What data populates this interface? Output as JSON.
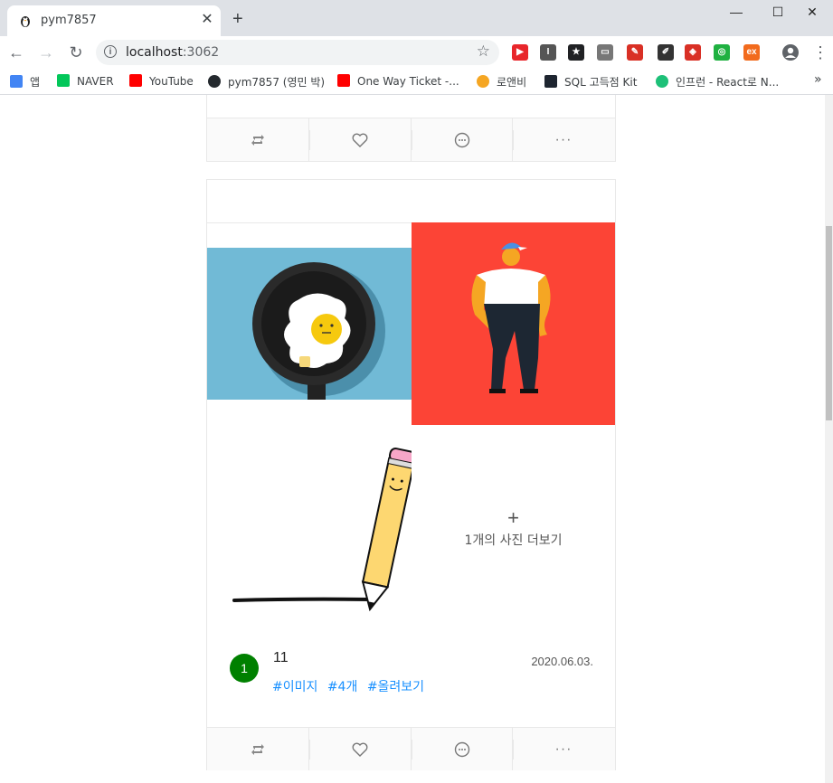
{
  "browser": {
    "tab_title": "pym7857",
    "url_host": "localhost",
    "url_port": ":3062",
    "window_controls": [
      "minimize",
      "maximize",
      "close"
    ],
    "extensions": [
      {
        "name": "video-speed",
        "color": "#e8262b",
        "glyph": "▶"
      },
      {
        "name": "instapaper",
        "color": "#555555",
        "glyph": "I"
      },
      {
        "name": "bookmark-star",
        "color": "#202124",
        "glyph": "★"
      },
      {
        "name": "screen-tool",
        "color": "#777777",
        "glyph": "▭"
      },
      {
        "name": "pen-tool",
        "color": "#d93025",
        "glyph": "✎"
      },
      {
        "name": "eyedropper",
        "color": "#333333",
        "glyph": "✐"
      },
      {
        "name": "grammar",
        "color": "#d93025",
        "glyph": "◈"
      },
      {
        "name": "chrome-ext",
        "color": "#1fb141",
        "glyph": "◎"
      },
      {
        "name": "ex-ext",
        "color": "#f26b1d",
        "glyph": "ex"
      }
    ]
  },
  "bookmarks": [
    {
      "label": "앱",
      "icon": "apps-grid-icon",
      "color": "#4285f4"
    },
    {
      "label": "NAVER",
      "icon": "naver-icon",
      "color": "#03c75a"
    },
    {
      "label": "YouTube",
      "icon": "youtube-icon",
      "color": "#ff0000"
    },
    {
      "label": "pym7857 (영민 박)",
      "icon": "github-icon",
      "color": "#24292e"
    },
    {
      "label": "One Way Ticket -...",
      "icon": "youtube-icon",
      "color": "#ff0000"
    },
    {
      "label": "로앤비",
      "icon": "lawnb-icon",
      "color": "#f5a623"
    },
    {
      "label": "SQL 고득점 Kit",
      "icon": "programmers-icon",
      "color": "#1e2530"
    },
    {
      "label": "인프런 - React로 N...",
      "icon": "inflearn-icon",
      "color": "#1dc078"
    }
  ],
  "post": {
    "author_initial": "1",
    "author_color": "#008000",
    "nickname": "11",
    "date": "2020.06.03.",
    "hashtags": [
      "#이미지",
      "#4개",
      "#올려보기"
    ],
    "more_images_label": "1개의 사진 더보기",
    "more_images_icon": "+",
    "images": [
      {
        "name": "fried-egg-pan",
        "bg": "#71bad6"
      },
      {
        "name": "man-with-cap",
        "bg": "#fc4436"
      },
      {
        "name": "pencil-drawing",
        "bg": "#ffffff"
      }
    ]
  },
  "actions": [
    {
      "name": "retweet-icon",
      "glyph": "⟲"
    },
    {
      "name": "heart-icon",
      "glyph": "♡"
    },
    {
      "name": "comment-icon",
      "glyph": "💬"
    },
    {
      "name": "ellipsis-icon",
      "glyph": "···"
    }
  ]
}
